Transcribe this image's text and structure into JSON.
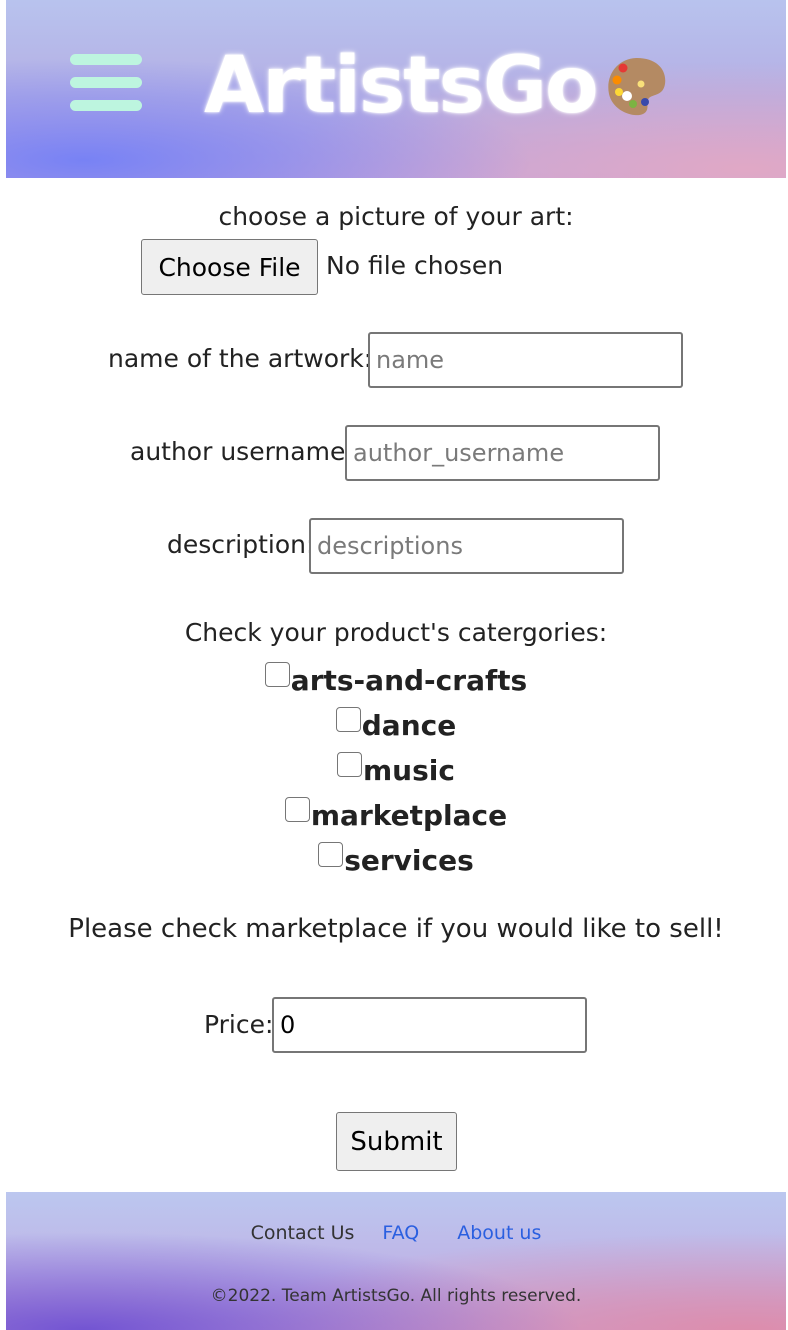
{
  "header": {
    "logo_text": "ArtistsGo",
    "menu_icon": "hamburger-menu-icon",
    "palette_icon": "paint-palette-icon",
    "colors": {
      "menu_bar": "#bdf5df",
      "gradient_left": "#7480f6",
      "gradient_right": "#e2a8c4"
    }
  },
  "form": {
    "picture_label": "choose a picture of your art:",
    "file_button_label": "Choose File",
    "file_status": "No file chosen",
    "artwork_name_label": "name of the artwork:",
    "artwork_name_placeholder": "name",
    "artwork_name_value": "",
    "author_label": "author username:",
    "author_placeholder": "author_username",
    "author_value": "",
    "description_label": "description:",
    "description_placeholder": "descriptions",
    "description_value": "",
    "categories_heading": "Check your product's catergories:",
    "categories": [
      {
        "label": "arts-and-crafts",
        "checked": false
      },
      {
        "label": "dance",
        "checked": false
      },
      {
        "label": "music",
        "checked": false
      },
      {
        "label": "marketplace",
        "checked": false
      },
      {
        "label": "services",
        "checked": false
      }
    ],
    "sell_hint": "Please check marketplace if you would like to sell!",
    "price_label": "Price:",
    "price_value": "0",
    "submit_label": "Submit"
  },
  "footer": {
    "links": [
      "Contact Us",
      "FAQ",
      "About us"
    ],
    "copyright": "©2022. Team ArtistsGo. All rights reserved.",
    "colors": {
      "link": "#2a5fe0"
    }
  }
}
